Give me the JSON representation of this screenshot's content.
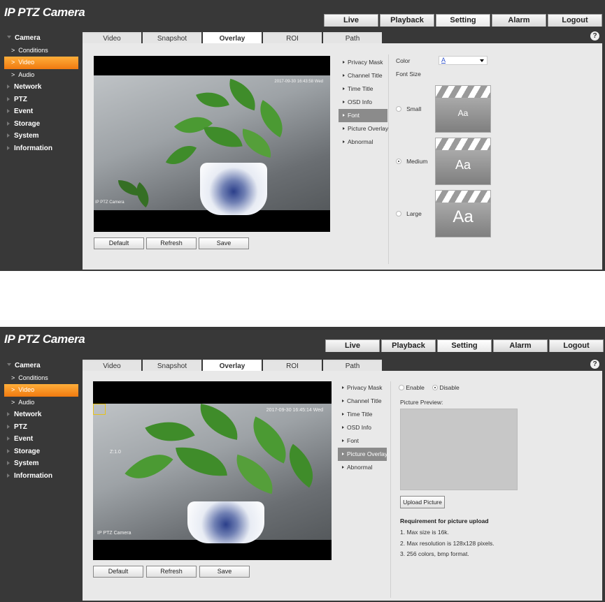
{
  "brand": "IP PTZ Camera",
  "top_nav": [
    "Live",
    "Playback",
    "Setting",
    "Alarm",
    "Logout"
  ],
  "top_nav_active": "Setting",
  "help_glyph": "?",
  "sidebar": {
    "camera": "Camera",
    "conditions": "Conditions",
    "video": "Video",
    "audio": "Audio",
    "network": "Network",
    "ptz": "PTZ",
    "event": "Event",
    "storage": "Storage",
    "system": "System",
    "information": "Information"
  },
  "tabs": [
    "Video",
    "Snapshot",
    "Overlay",
    "ROI",
    "Path"
  ],
  "tabs_active": "Overlay",
  "overlay_menu": [
    "Privacy Mask",
    "Channel Title",
    "Time Title",
    "OSD Info",
    "Font",
    "Picture Overlay",
    "Abnormal"
  ],
  "buttons": {
    "default": "Default",
    "refresh": "Refresh",
    "save": "Save"
  },
  "screen1": {
    "selected_menu": "Font",
    "osd_time": "2017-09-30 16:43:58 Wed",
    "osd_title": "IP PTZ Camera",
    "color_label": "Color",
    "color_value": "A",
    "font_size_label": "Font Size",
    "sizes": [
      {
        "label": "Small",
        "checked": false,
        "sample": "Aa"
      },
      {
        "label": "Medium",
        "checked": true,
        "sample": "Aa"
      },
      {
        "label": "Large",
        "checked": false,
        "sample": "Aa"
      }
    ]
  },
  "screen2": {
    "selected_menu": "Picture Overlay",
    "osd_time": "2017-09-30 16:45:14 Wed",
    "osd_zoom": "Z:1.0",
    "osd_title": "IP PTZ Camera",
    "enable_label": "Enable",
    "disable_label": "Disable",
    "enable_state": "Disable",
    "preview_label": "Picture Preview:",
    "upload_label": "Upload Picture",
    "req_title": "Requirement for picture upload",
    "req_items": [
      "1. Max size is 16k.",
      "2. Max resolution is 128x128 pixels.",
      "3. 256 colors, bmp format."
    ]
  },
  "colors": {
    "frame_bg": "#383838",
    "panel_bg": "#e9e9e9",
    "active_orange": "#f08a20",
    "menu_selected": "#8b8b8b"
  }
}
